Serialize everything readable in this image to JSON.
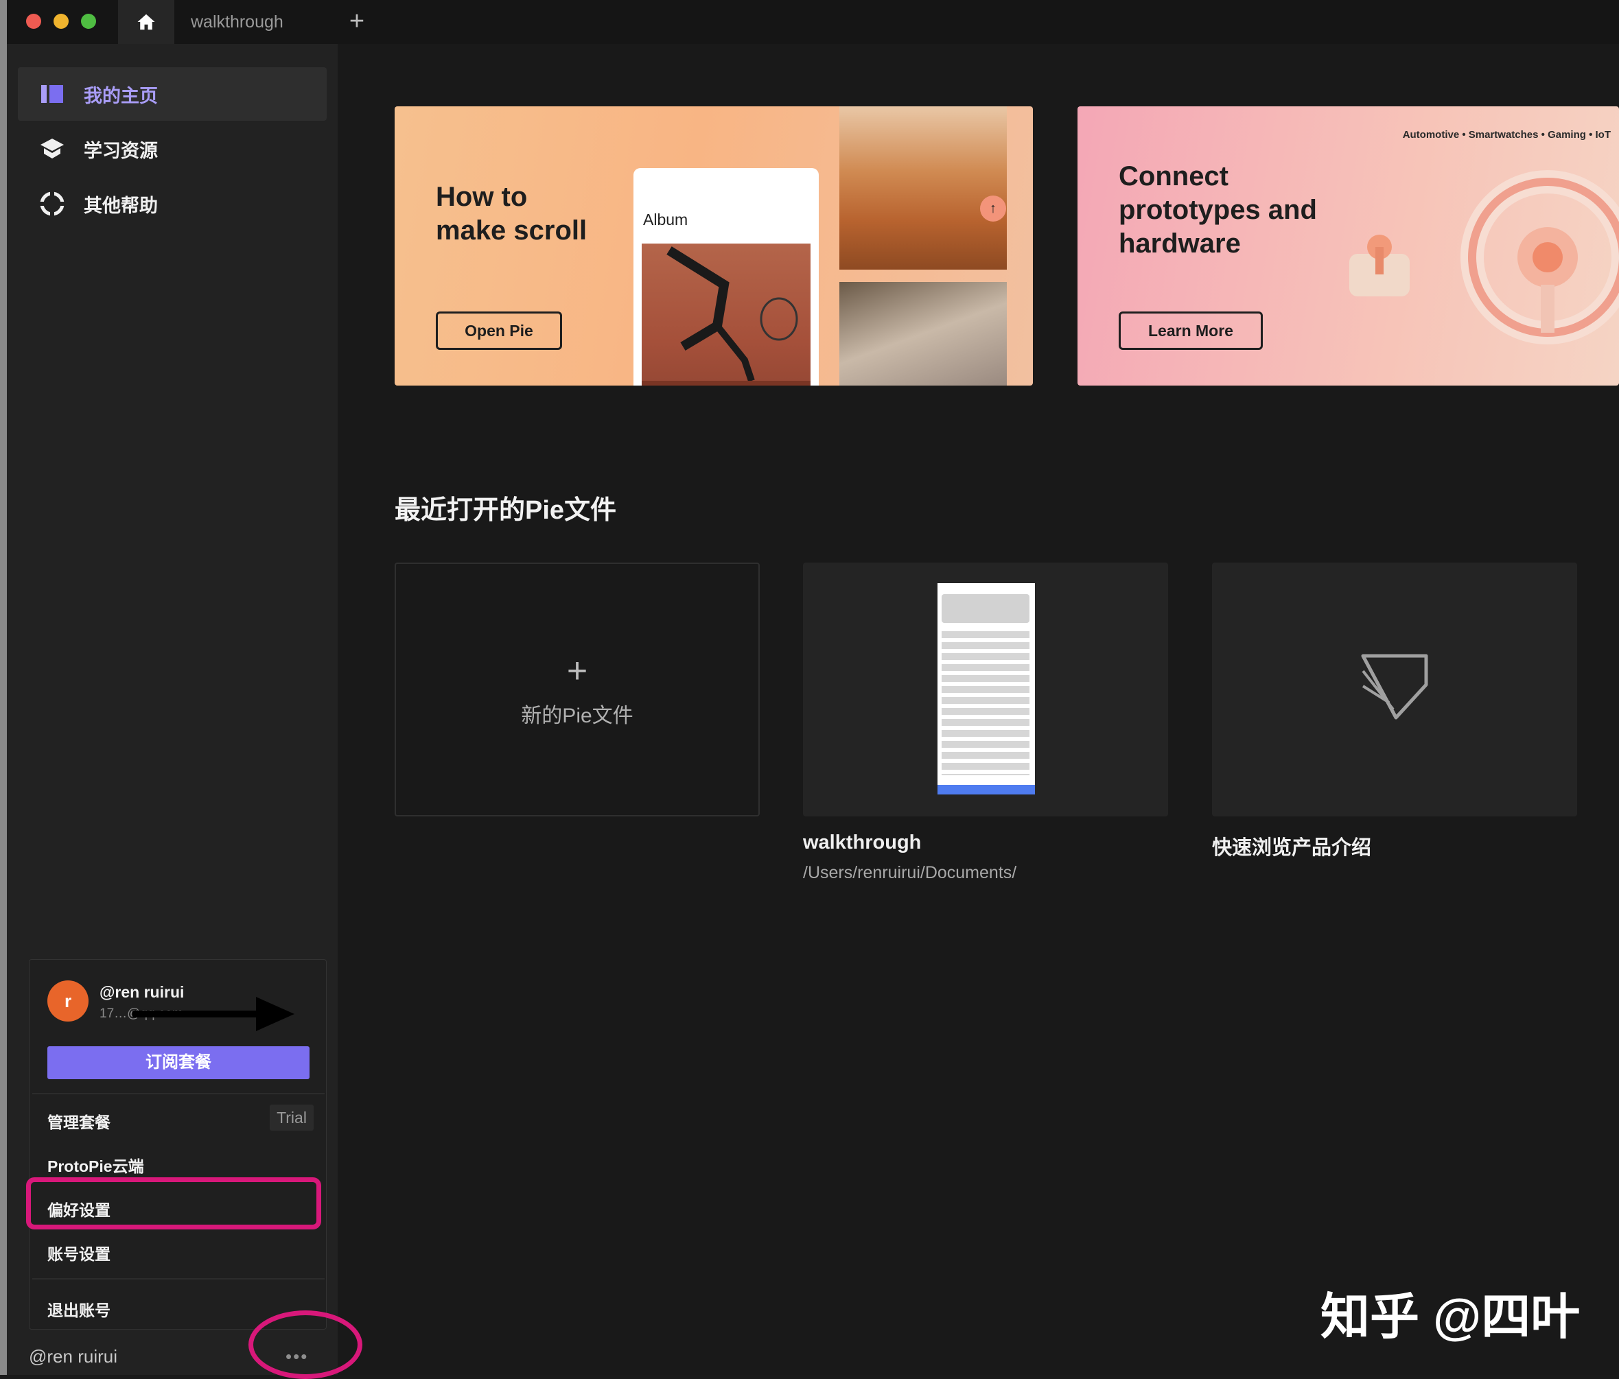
{
  "titlebar": {
    "tab_document": "walkthrough",
    "new_tab": "+"
  },
  "sidebar": {
    "items": [
      {
        "label": "我的主页"
      },
      {
        "label": "学习资源"
      },
      {
        "label": "其他帮助"
      }
    ]
  },
  "banners": [
    {
      "title": "How to\nmake scroll",
      "button": "Open Pie",
      "album_label": "Album"
    },
    {
      "title": "Connect\nprototypes and\nhardware",
      "button": "Learn More",
      "tags": "Automotive  •  Smartwatches  •  Gaming  •  IoT"
    }
  ],
  "recent": {
    "title": "最近打开的Pie文件",
    "new_plus": "+",
    "new_label": "新的Pie文件",
    "files": [
      {
        "name": "walkthrough",
        "path": "/Users/renruirui/Documents/"
      },
      {
        "name": "快速浏览产品介绍",
        "path": ""
      }
    ]
  },
  "account_menu": {
    "avatar_letter": "r",
    "username": "@ren ruirui",
    "email_masked": "17…@qq.com",
    "subscribe": "订阅套餐",
    "manage_plan": "管理套餐",
    "plan_badge": "Trial",
    "cloud": "ProtoPie云端",
    "preferences": "偏好设置",
    "account_settings": "账号设置",
    "logout": "退出账号"
  },
  "footer": {
    "username": "@ren ruirui",
    "more": "•••"
  },
  "watermark": "知乎 @四叶",
  "colors": {
    "accent": "#7b6ef0",
    "active_nav": "#a99df7",
    "annotation": "#d8187a",
    "avatar": "#e8652a"
  }
}
